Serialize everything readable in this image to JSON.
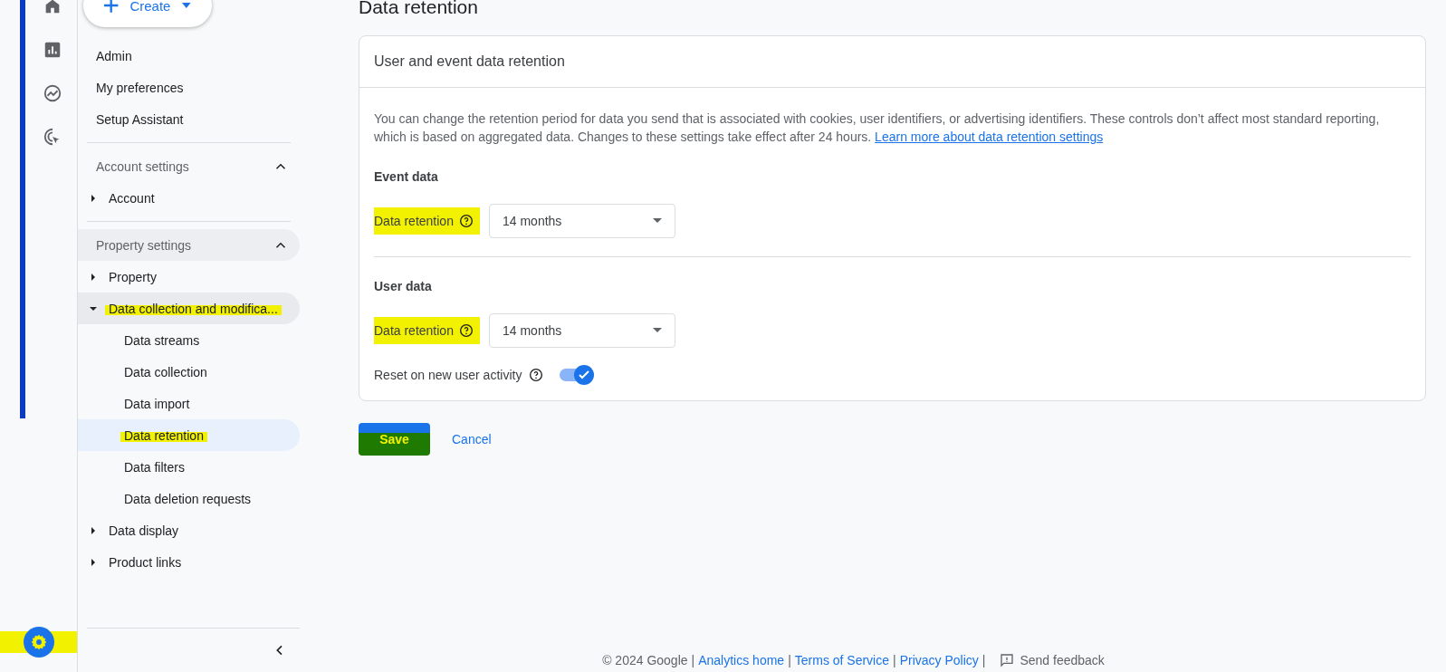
{
  "rail": {
    "items": [
      {
        "kind": "home"
      },
      {
        "kind": "reports"
      },
      {
        "kind": "explore"
      },
      {
        "kind": "advertising"
      }
    ],
    "settings": {
      "highlighted": true
    }
  },
  "create": {
    "label": "Create"
  },
  "sidebar": {
    "top_items": [
      "Admin",
      "My preferences",
      "Setup Assistant"
    ],
    "sections": [
      {
        "title": "Account settings",
        "expanded": true,
        "selected": false,
        "items": [
          {
            "label": "Account",
            "expanded": false,
            "selected": false,
            "highlighted": false
          }
        ]
      },
      {
        "title": "Property settings",
        "expanded": true,
        "selected": true,
        "items": [
          {
            "label": "Property",
            "expanded": false,
            "selected": false,
            "highlighted": false
          },
          {
            "label": "Data collection and modifica...",
            "expanded": true,
            "selected": true,
            "highlighted": true,
            "children": [
              {
                "label": "Data streams",
                "selected": false,
                "highlighted": false
              },
              {
                "label": "Data collection",
                "selected": false,
                "highlighted": false
              },
              {
                "label": "Data import",
                "selected": false,
                "highlighted": false
              },
              {
                "label": "Data retention",
                "selected": true,
                "highlighted": true
              },
              {
                "label": "Data filters",
                "selected": false,
                "highlighted": false
              },
              {
                "label": "Data deletion requests",
                "selected": false,
                "highlighted": false
              }
            ]
          },
          {
            "label": "Data display",
            "expanded": false,
            "selected": false,
            "highlighted": false
          },
          {
            "label": "Product links",
            "expanded": false,
            "selected": false,
            "highlighted": false
          }
        ]
      }
    ]
  },
  "page": {
    "title": "Data retention",
    "card": {
      "title": "User and event data retention",
      "description": "You can change the retention period for data you send that is associated with cookies, user identifiers, or advertising identifiers. These controls don’t affect most standard reporting, which is based on aggregated data. Changes to these settings take effect after 24 hours.",
      "link": "Learn more about data retention settings",
      "groups": [
        {
          "heading": "Event data",
          "field": {
            "label": "Data retention",
            "value": "14 months",
            "highlighted": true
          }
        },
        {
          "heading": "User data",
          "field": {
            "label": "Data retention",
            "value": "14 months",
            "highlighted": true
          },
          "toggle": {
            "label": "Reset on new user activity",
            "on": true
          }
        }
      ]
    },
    "actions": {
      "save": {
        "label": "Save",
        "highlighted": true
      },
      "cancel": {
        "label": "Cancel"
      }
    }
  },
  "footer": {
    "items": [
      {
        "kind": "text",
        "text": "© 2024 Google"
      },
      {
        "kind": "separator",
        "text": "|"
      },
      {
        "kind": "link",
        "text": "Analytics home"
      },
      {
        "kind": "separator",
        "text": "|"
      },
      {
        "kind": "link",
        "text": "Terms of Service"
      },
      {
        "kind": "separator",
        "text": "|"
      },
      {
        "kind": "link",
        "text": "Privacy Policy"
      },
      {
        "kind": "separator",
        "text": "|"
      },
      {
        "kind": "feedback",
        "text": "Send feedback"
      }
    ]
  }
}
